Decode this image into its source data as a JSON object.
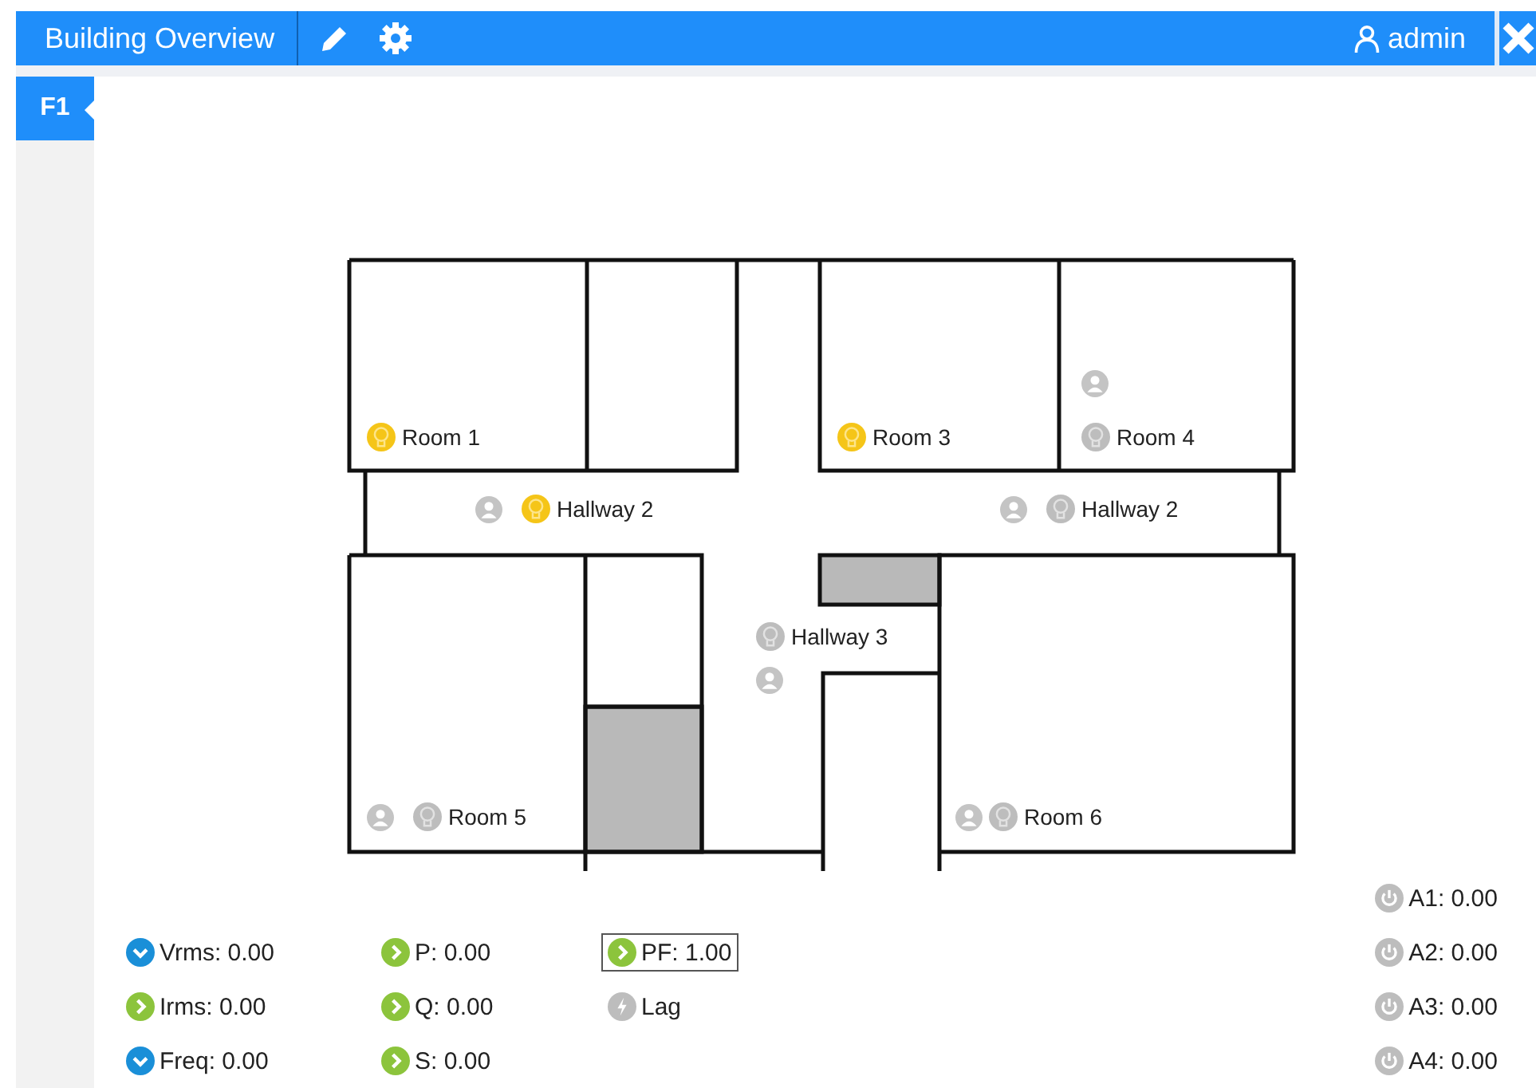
{
  "header": {
    "title": "Building Overview",
    "user": "admin"
  },
  "floors": [
    {
      "label": "F1",
      "selected": true
    }
  ],
  "zones": [
    {
      "name": "Room 1",
      "light_on": true,
      "has_sensor": false
    },
    {
      "name": "Hallway 2",
      "light_on": true,
      "has_sensor": true
    },
    {
      "name": "Room 3",
      "light_on": true,
      "has_sensor": false
    },
    {
      "name": "Room 4",
      "light_on": false,
      "has_sensor": true
    },
    {
      "name": "Hallway 2",
      "light_on": false,
      "has_sensor": true
    },
    {
      "name": "Hallway 3",
      "light_on": false,
      "has_sensor": true
    },
    {
      "name": "Room 5",
      "light_on": false,
      "has_sensor": true
    },
    {
      "name": "Room 6",
      "light_on": false,
      "has_sensor": true
    }
  ],
  "meter_columns": [
    {
      "items": [
        {
          "text": "Vrms: 0.00",
          "kind": "down",
          "selected": false
        },
        {
          "text": "Irms: 0.00",
          "kind": "right",
          "selected": false
        },
        {
          "text": "Freq: 0.00",
          "kind": "down",
          "selected": false
        }
      ]
    },
    {
      "items": [
        {
          "text": "P: 0.00",
          "kind": "right",
          "selected": false
        },
        {
          "text": "Q: 0.00",
          "kind": "right",
          "selected": false
        },
        {
          "text": "S: 0.00",
          "kind": "right",
          "selected": false
        }
      ]
    },
    {
      "items": [
        {
          "text": "PF: 1.00",
          "kind": "right",
          "selected": true
        },
        {
          "text": "Lag",
          "kind": "bolt",
          "selected": false
        }
      ]
    }
  ],
  "analog_inputs": [
    {
      "text": "A1: 0.00",
      "kind": "power"
    },
    {
      "text": "A2: 0.00",
      "kind": "power"
    },
    {
      "text": "A3: 0.00",
      "kind": "power"
    },
    {
      "text": "A4: 0.00",
      "kind": "power"
    }
  ]
}
